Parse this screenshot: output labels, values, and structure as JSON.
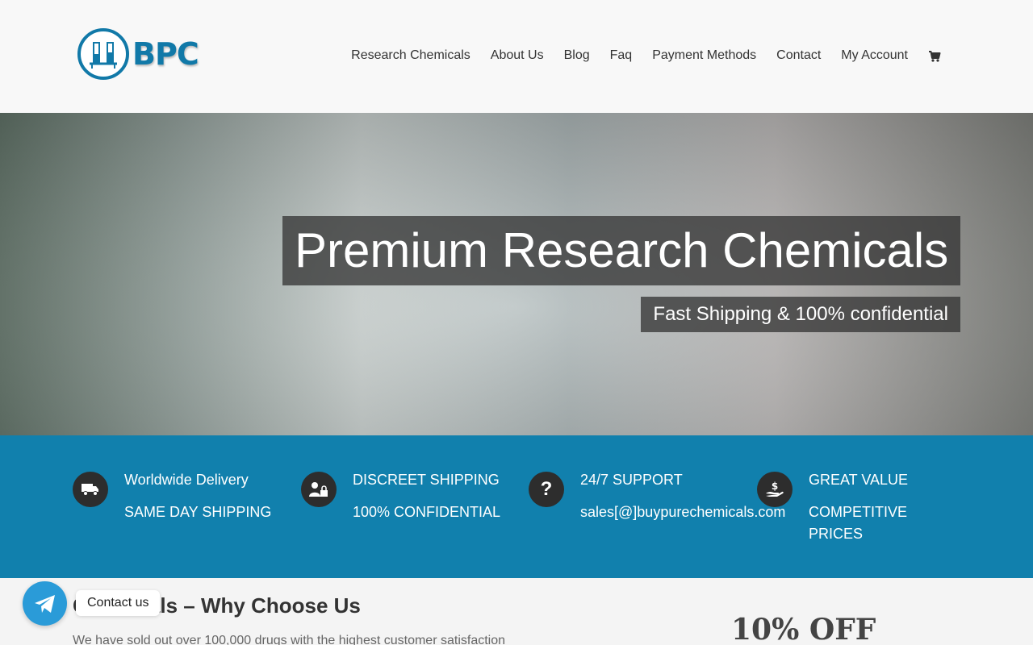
{
  "brand": {
    "logo_text": "BPC"
  },
  "nav": {
    "items": [
      "Research Chemicals",
      "About Us",
      "Blog",
      "Faq",
      "Payment Methods",
      "Contact",
      "My Account"
    ],
    "cart_icon": "cart-icon"
  },
  "hero": {
    "title": "Premium Research Chemicals",
    "subtitle": "Fast Shipping & 100% confidential"
  },
  "features": [
    {
      "icon": "truck-icon",
      "line1": "Worldwide Delivery",
      "line2": "SAME DAY SHIPPING"
    },
    {
      "icon": "user-lock-icon",
      "line1": "DISCREET SHIPPING",
      "line2": "100% CONFIDENTIAL"
    },
    {
      "icon": "question-icon",
      "line1": "24/7 SUPPORT",
      "line2": "sales[@]buypurechemicals.com"
    },
    {
      "icon": "hand-dollar-icon",
      "line1": "GREAT VALUE",
      "line2": "COMPETITIVE",
      "line3": "PRICES"
    }
  ],
  "content": {
    "title": "Chemicals – Why Choose Us",
    "intro": "We have sold out over 100,000 drugs with the highest customer satisfaction",
    "promo": "10% OFF"
  },
  "widget": {
    "label": "Contact us",
    "icon": "telegram-icon"
  },
  "colors": {
    "brand_blue": "#1179a8",
    "band_blue": "#1180ad",
    "telegram": "#2a9bd8"
  }
}
